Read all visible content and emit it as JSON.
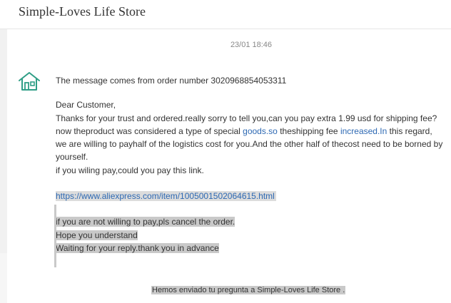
{
  "header": {
    "store_name": "Simple-Loves Life Store"
  },
  "conversation": {
    "timestamp": "23/01 18:46"
  },
  "message": {
    "icon": "house-icon",
    "order_line": "The message comes from order number 3020968854053311",
    "greeting": "Dear Customer,",
    "body_part1": "Thanks for your trust and ordered.really sorry to tell you,can you pay extra 1.99 usd for shipping fee?now theproduct was considered a type of special ",
    "link_goods": "goods.so",
    "body_part2": " theshipping fee ",
    "link_increased": "increased.In",
    "body_part3": " this regard, we are willing to payhalf of the logistics cost for you.And the other half of thecost need to be borned by yourself.",
    "pay_line": "if you wiling pay,could you pay this link.",
    "product_link": "https://www.aliexpress.com/item/1005001502064615.html",
    "cancel_line": "if you are not willing to pay,pls cancel the order.",
    "hope_line": "Hope you understand",
    "waiting_line": "Waiting for your reply.thank you in advance"
  },
  "footer": {
    "sent_notice": "Hemos enviado tu pregunta a Simple-Loves Life Store ."
  },
  "colors": {
    "link": "#2e69b3",
    "highlight": "#c9c9c9",
    "icon": "#2f9e86"
  }
}
